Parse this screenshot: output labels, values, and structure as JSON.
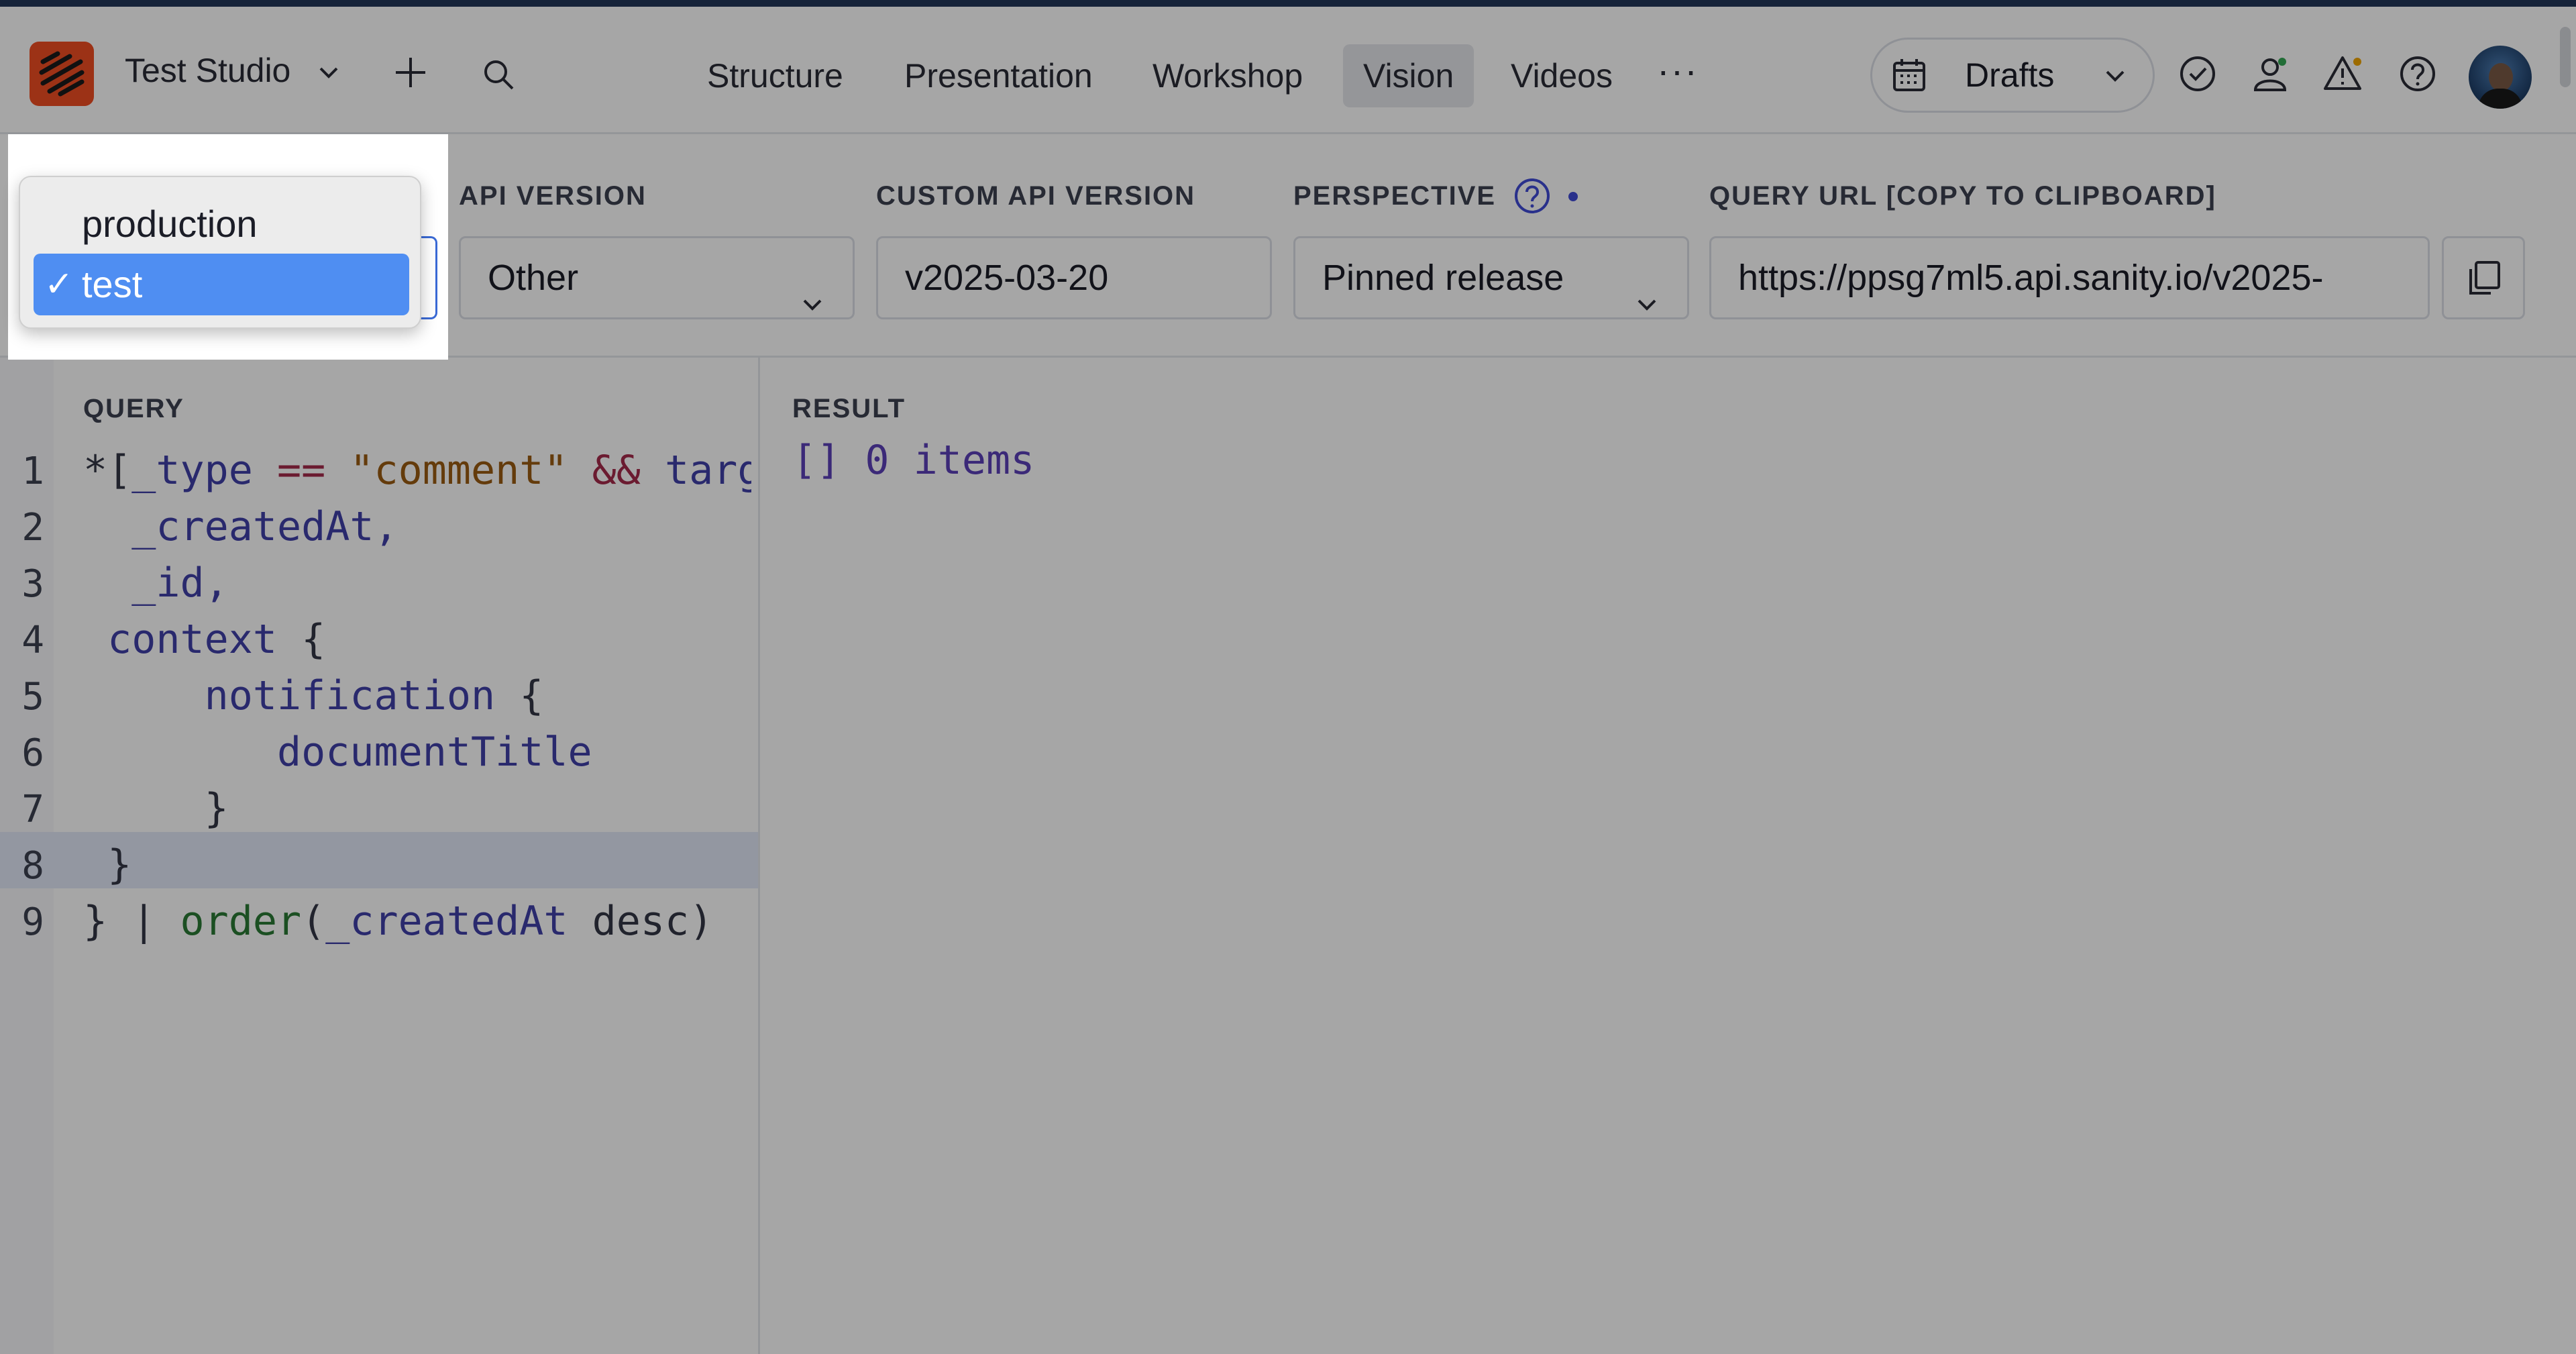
{
  "header": {
    "studio_name": "Test Studio",
    "nav": [
      "Structure",
      "Presentation",
      "Workshop",
      "Vision",
      "Videos"
    ],
    "active_nav": "Vision",
    "more": "···",
    "release_selector": "Drafts"
  },
  "toolbar": {
    "dataset_label": "",
    "api_version_label": "API VERSION",
    "api_version_value": "Other",
    "custom_api_version_label": "CUSTOM API VERSION",
    "custom_api_version_value": "v2025-03-20",
    "perspective_label": "PERSPECTIVE",
    "perspective_value": "Pinned release",
    "query_url_label": "QUERY URL [COPY TO CLIPBOARD]",
    "query_url_value": "https://ppsg7ml5.api.sanity.io/v2025-"
  },
  "query": {
    "title": "QUERY",
    "line_numbers": [
      "1",
      "2",
      "3",
      "4",
      "5",
      "6",
      "7",
      "8",
      "9"
    ],
    "lines": [
      [
        [
          "*[",
          "pl"
        ],
        [
          "_type",
          "kw"
        ],
        [
          " == ",
          "op"
        ],
        [
          "\"comment\"",
          "str"
        ],
        [
          " && ",
          "op"
        ],
        [
          "targ",
          "kw"
        ]
      ],
      [
        [
          "  _createdAt",
          "kw"
        ],
        [
          ",",
          "kw"
        ]
      ],
      [
        [
          "  _id",
          "kw"
        ],
        [
          ",",
          "kw"
        ]
      ],
      [
        [
          " context",
          "kw"
        ],
        [
          " {",
          "pl"
        ]
      ],
      [
        [
          "     notification",
          "kw"
        ],
        [
          " {",
          "pl"
        ]
      ],
      [
        [
          "        documentTitle",
          "kw"
        ]
      ],
      [
        [
          "     }",
          "pl"
        ]
      ],
      [
        [
          " }",
          "pl"
        ]
      ],
      [
        [
          "} | ",
          "pl"
        ],
        [
          "order",
          "fn"
        ],
        [
          "(",
          "pl"
        ],
        [
          "_createdAt",
          "kw"
        ],
        [
          " desc)",
          "pl"
        ]
      ]
    ],
    "highlighted_line": "8"
  },
  "result": {
    "title": "RESULT",
    "text": "[] 0 items"
  },
  "dataset_dropdown": {
    "options": [
      "production",
      "test"
    ],
    "selected": "test",
    "check": "✓"
  },
  "colors": {
    "brand": "#f04d23",
    "selection": "#4f8ef2",
    "keyword": "#3f3fa8",
    "string": "#9a5b12",
    "operator": "#a52a4a",
    "function": "#2a7a35"
  },
  "icons": [
    "studio-logo-icon",
    "chevron-down-icon",
    "plus-icon",
    "search-icon",
    "calendar-icon",
    "check-circle-icon",
    "users-icon",
    "warning-icon",
    "help-circle-icon",
    "copy-icon"
  ]
}
